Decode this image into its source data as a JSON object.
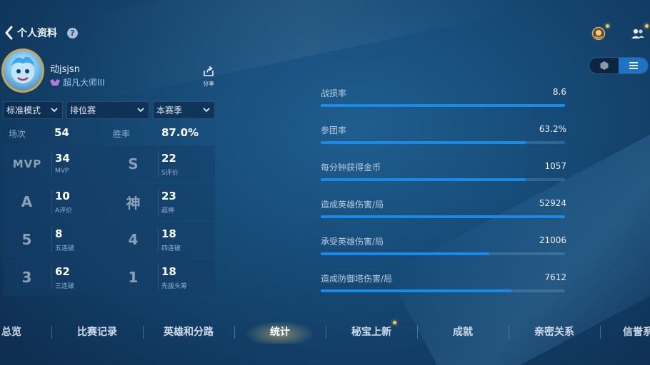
{
  "header": {
    "title": "个人资料",
    "help_glyph": "?"
  },
  "profile": {
    "username": "动jsjsn",
    "rank": "超凡大师III",
    "share_label": "分享"
  },
  "filters": [
    {
      "label": "标准模式"
    },
    {
      "label": "排位赛"
    },
    {
      "label": "本赛季"
    }
  ],
  "summary": {
    "matches_label": "场次",
    "matches_value": "54",
    "winrate_label": "胜率",
    "winrate_value": "87.0%"
  },
  "stats": [
    {
      "icon_text": "MVP",
      "value": "34",
      "label": "MVP"
    },
    {
      "icon_text": "S",
      "value": "22",
      "label": "S评价"
    },
    {
      "icon_text": "A",
      "value": "10",
      "label": "A评价"
    },
    {
      "icon_text": "神",
      "value": "23",
      "label": "超神"
    },
    {
      "icon_text": "5",
      "value": "8",
      "label": "五连破"
    },
    {
      "icon_text": "4",
      "value": "18",
      "label": "四连破"
    },
    {
      "icon_text": "3",
      "value": "62",
      "label": "三连破"
    },
    {
      "icon_text": "1",
      "value": "18",
      "label": "先拔头筹"
    }
  ],
  "metrics": [
    {
      "label": "战损率",
      "value": "8.6",
      "fill": 1.0
    },
    {
      "label": "参团率",
      "value": "63.2%",
      "fill": 0.84
    },
    {
      "label": "每分钟获得金币",
      "value": "1057",
      "fill": 0.84
    },
    {
      "label": "造成英雄伤害/局",
      "value": "52924",
      "fill": 1.0
    },
    {
      "label": "承受英雄伤害/局",
      "value": "21006",
      "fill": 0.69
    },
    {
      "label": "造成防御塔伤害/局",
      "value": "7612",
      "fill": 0.78
    }
  ],
  "nav": [
    {
      "label": "总览",
      "active": false,
      "dot": false
    },
    {
      "label": "比赛记录",
      "active": false,
      "dot": false
    },
    {
      "label": "英雄和分路",
      "active": false,
      "dot": false
    },
    {
      "label": "统计",
      "active": true,
      "dot": false
    },
    {
      "label": "秘宝上新",
      "active": false,
      "dot": true
    },
    {
      "label": "成就",
      "active": false,
      "dot": false
    },
    {
      "label": "亲密关系",
      "active": false,
      "dot": false
    },
    {
      "label": "信誉系",
      "active": false,
      "dot": false
    }
  ],
  "colors": {
    "accent": "#1b8ae6",
    "gold": "#f5c25a",
    "toggle_active": "#1d73c6"
  }
}
